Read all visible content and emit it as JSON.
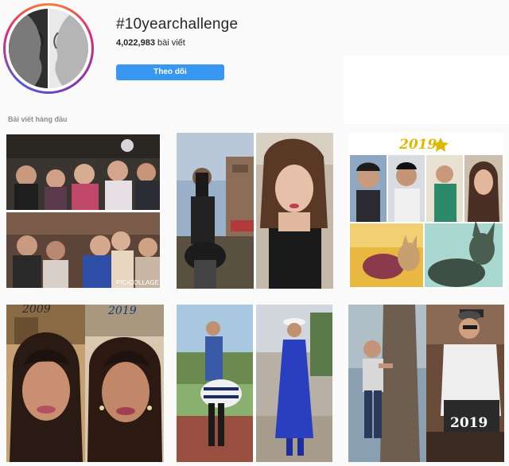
{
  "header": {
    "hashtag": "#10yearchallenge",
    "post_count": "4,022,983",
    "post_count_label": "bài viết",
    "follow_label": "Theo dõi"
  },
  "avatar": {
    "icon": "split-face-portrait"
  },
  "top_posts": {
    "label": "Bài viết hàng đầu",
    "posts": [
      {
        "name": "group-of-women-collage",
        "caption": "PIC•COLLAGE"
      },
      {
        "name": "woman-then-now-collage",
        "caption": ""
      },
      {
        "name": "children-and-dogs-collage",
        "caption": "2019"
      },
      {
        "name": "woman-2009-2019-collage",
        "caption_left": "2009",
        "caption_right": "2019"
      },
      {
        "name": "woman-blue-dress-collage",
        "caption": ""
      },
      {
        "name": "boy-tree-and-man-collage",
        "caption": "2019"
      }
    ]
  },
  "colors": {
    "follow_button": "#3897f0",
    "gold_year": "#e0b800"
  }
}
